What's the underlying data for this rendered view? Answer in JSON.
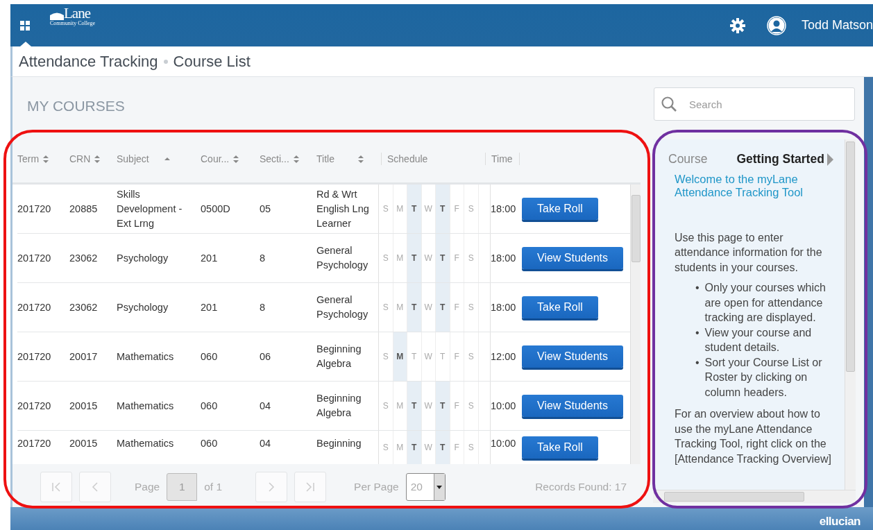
{
  "header": {
    "logo_name": "Lane",
    "logo_sub": "Community College",
    "user": "Todd Matson"
  },
  "breadcrumb": [
    "Attendance Tracking",
    "Course List"
  ],
  "section_title": "MY COURSES",
  "search": {
    "placeholder": "Search"
  },
  "table": {
    "columns": [
      {
        "label": "Term",
        "sortable": true,
        "sorted": false
      },
      {
        "label": "CRN",
        "sortable": true,
        "sorted": false
      },
      {
        "label": "Subject",
        "sortable": true,
        "sorted": true
      },
      {
        "label": "Cour...",
        "sortable": true,
        "sorted": false
      },
      {
        "label": "Secti...",
        "sortable": true,
        "sorted": false
      },
      {
        "label": "Title",
        "sortable": true,
        "sorted": false
      },
      {
        "label": "Schedule",
        "sortable": false,
        "sorted": false
      },
      {
        "label": "Time",
        "sortable": false,
        "sorted": false
      }
    ],
    "rows": [
      {
        "term": "201720",
        "crn": "20885",
        "subject": "Skills Development - Ext Lrng",
        "course": "0500D",
        "section": "05",
        "title": "Rd & Wrt English Lng Learner",
        "days": [
          {
            "letter": "S",
            "on": false
          },
          {
            "letter": "M",
            "on": false
          },
          {
            "letter": "T",
            "on": true
          },
          {
            "letter": "W",
            "on": false
          },
          {
            "letter": "T",
            "on": true
          },
          {
            "letter": "F",
            "on": false
          },
          {
            "letter": "S",
            "on": false
          }
        ],
        "time": "18:00",
        "action": "Take Roll"
      },
      {
        "term": "201720",
        "crn": "23062",
        "subject": "Psychology",
        "course": "201",
        "section": "8",
        "title": "General Psychology",
        "days": [
          {
            "letter": "S",
            "on": false
          },
          {
            "letter": "M",
            "on": false
          },
          {
            "letter": "T",
            "on": true
          },
          {
            "letter": "W",
            "on": false
          },
          {
            "letter": "T",
            "on": true
          },
          {
            "letter": "F",
            "on": false
          },
          {
            "letter": "S",
            "on": false
          }
        ],
        "time": "18:00",
        "action": "View Students"
      },
      {
        "term": "201720",
        "crn": "23062",
        "subject": "Psychology",
        "course": "201",
        "section": "8",
        "title": "General Psychology",
        "days": [
          {
            "letter": "S",
            "on": false
          },
          {
            "letter": "M",
            "on": false
          },
          {
            "letter": "T",
            "on": true
          },
          {
            "letter": "W",
            "on": false
          },
          {
            "letter": "T",
            "on": true
          },
          {
            "letter": "F",
            "on": false
          },
          {
            "letter": "S",
            "on": false
          }
        ],
        "time": "18:00",
        "action": "Take Roll"
      },
      {
        "term": "201720",
        "crn": "20017",
        "subject": "Mathematics",
        "course": "060",
        "section": "06",
        "title": "Beginning Algebra",
        "days": [
          {
            "letter": "S",
            "on": false
          },
          {
            "letter": "M",
            "on": true
          },
          {
            "letter": "T",
            "on": false
          },
          {
            "letter": "W",
            "on": false
          },
          {
            "letter": "T",
            "on": false
          },
          {
            "letter": "F",
            "on": false
          },
          {
            "letter": "S",
            "on": false
          }
        ],
        "time": "12:00",
        "action": "View Students"
      },
      {
        "term": "201720",
        "crn": "20015",
        "subject": "Mathematics",
        "course": "060",
        "section": "04",
        "title": "Beginning Algebra",
        "days": [
          {
            "letter": "S",
            "on": false
          },
          {
            "letter": "M",
            "on": false
          },
          {
            "letter": "T",
            "on": true
          },
          {
            "letter": "W",
            "on": false
          },
          {
            "letter": "T",
            "on": true
          },
          {
            "letter": "F",
            "on": false
          },
          {
            "letter": "S",
            "on": false
          }
        ],
        "time": "10:00",
        "action": "View Students"
      },
      {
        "term": "201720",
        "crn": "20015",
        "subject": "Mathematics",
        "course": "060",
        "section": "04",
        "title": "Beginning",
        "days": [
          {
            "letter": "S",
            "on": false
          },
          {
            "letter": "M",
            "on": false
          },
          {
            "letter": "T",
            "on": true
          },
          {
            "letter": "W",
            "on": false
          },
          {
            "letter": "T",
            "on": true
          },
          {
            "letter": "F",
            "on": false
          },
          {
            "letter": "S",
            "on": false
          }
        ],
        "time": "10:00",
        "action": "Take Roll"
      }
    ]
  },
  "pager": {
    "nav_before": [
      {
        "kind": "first",
        "disabled": true
      },
      {
        "kind": "prev",
        "disabled": true
      }
    ],
    "page_label": "Page",
    "page": "1",
    "of": "of 1",
    "nav_after": [
      {
        "kind": "next",
        "disabled": true
      },
      {
        "kind": "last",
        "disabled": true
      }
    ],
    "per_page_label": "Per Page",
    "per_page": "20",
    "records": "Records Found: 17"
  },
  "help": {
    "tabs": [
      {
        "label": "Course",
        "selected": false
      },
      {
        "label": "Getting Started",
        "selected": true
      }
    ],
    "heading": "Welcome to the myLane Attendance Tracking Tool",
    "intro": "Use this page to enter attendance information for the students in your courses.",
    "bullet": "•",
    "bullets": [
      "Only your courses which are open for attendance tracking are displayed.",
      "View your course and student details.",
      "Sort your Course List or Roster by clicking on column headers."
    ],
    "outro": "For an overview about how to use the myLane Attendance Tracking Tool, right click on the [Attendance Tracking Overview]"
  },
  "footer": {
    "brand": "ellucian"
  },
  "annotations": [
    {
      "kind": "table",
      "color": "#ee1111"
    },
    {
      "kind": "help",
      "color": "#7030a0"
    }
  ]
}
